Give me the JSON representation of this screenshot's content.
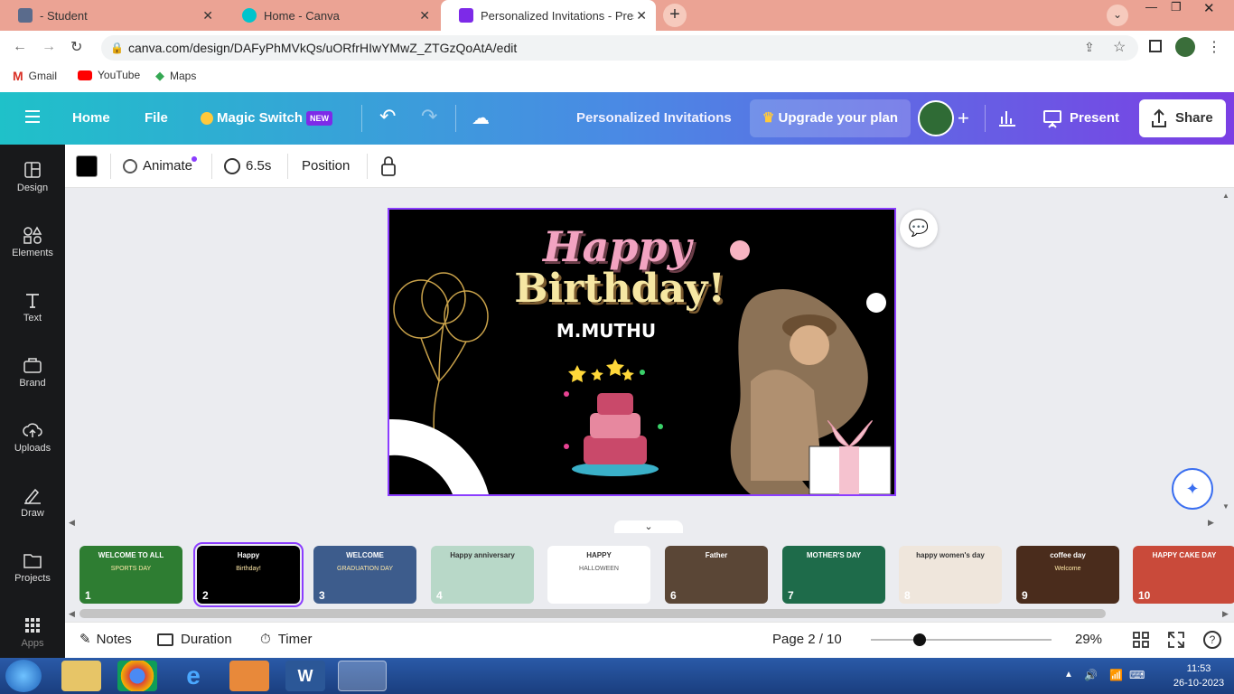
{
  "browser": {
    "tabs": [
      {
        "title": "- Student",
        "favicon_color": "#5a6b8c"
      },
      {
        "title": "Home - Canva",
        "favicon_color": "#00c4cc"
      },
      {
        "title": "Personalized Invitations - Present",
        "favicon_color": "#7d2ae8"
      }
    ],
    "url": "canva.com/design/DAFyPhMVkQs/uORfrHIwYMwZ_ZTGzQoAtA/edit",
    "bookmarks": [
      "Gmail",
      "YouTube",
      "Maps"
    ]
  },
  "header": {
    "home": "Home",
    "file": "File",
    "magic_switch": "Magic Switch",
    "new_badge": "NEW",
    "design_title": "Personalized Invitations",
    "upgrade": "Upgrade your plan",
    "present": "Present",
    "share": "Share"
  },
  "sidebar": {
    "items": [
      {
        "label": "Design",
        "icon": "layout-icon"
      },
      {
        "label": "Elements",
        "icon": "shapes-icon"
      },
      {
        "label": "Text",
        "icon": "text-icon"
      },
      {
        "label": "Brand",
        "icon": "brand-icon"
      },
      {
        "label": "Uploads",
        "icon": "cloud-upload-icon"
      },
      {
        "label": "Draw",
        "icon": "pen-icon"
      },
      {
        "label": "Projects",
        "icon": "folder-icon"
      },
      {
        "label": "Apps",
        "icon": "grid-icon"
      }
    ]
  },
  "toolbar": {
    "animate": "Animate",
    "duration": "6.5s",
    "position": "Position"
  },
  "design": {
    "happy": "Happy",
    "birthday": "Birthday!",
    "name": "M.MUTHU"
  },
  "pages": [
    {
      "number": "1",
      "label": "WELCOME TO ALL",
      "sub": "SPORTS DAY",
      "bg": "#2e7d32"
    },
    {
      "number": "2",
      "label": "Happy",
      "sub": "Birthday!",
      "bg": "#000000"
    },
    {
      "number": "3",
      "label": "WELCOME",
      "sub": "GRADUATION DAY",
      "bg": "#3d5c8c"
    },
    {
      "number": "4",
      "label": "Happy anniversary",
      "sub": "",
      "bg": "#b8d8c8"
    },
    {
      "number": "5",
      "label": "HAPPY",
      "sub": "HALLOWEEN",
      "bg": "#ffffff"
    },
    {
      "number": "6",
      "label": "Father",
      "sub": "",
      "bg": "#5a4636"
    },
    {
      "number": "7",
      "label": "MOTHER'S DAY",
      "sub": "",
      "bg": "#1e6b4a"
    },
    {
      "number": "8",
      "label": "happy women's day",
      "sub": "",
      "bg": "#efe6dc"
    },
    {
      "number": "9",
      "label": "coffee day",
      "sub": "Welcome",
      "bg": "#4a2c1c"
    },
    {
      "number": "10",
      "label": "HAPPY CAKE DAY",
      "sub": "",
      "bg": "#c94a3a"
    }
  ],
  "footer": {
    "notes": "Notes",
    "duration": "Duration",
    "timer": "Timer",
    "page_indicator": "Page 2 / 10",
    "zoom": "29%",
    "zoom_level": 0.29
  },
  "taskbar": {
    "time": "11:53",
    "date": "26-10-2023"
  }
}
